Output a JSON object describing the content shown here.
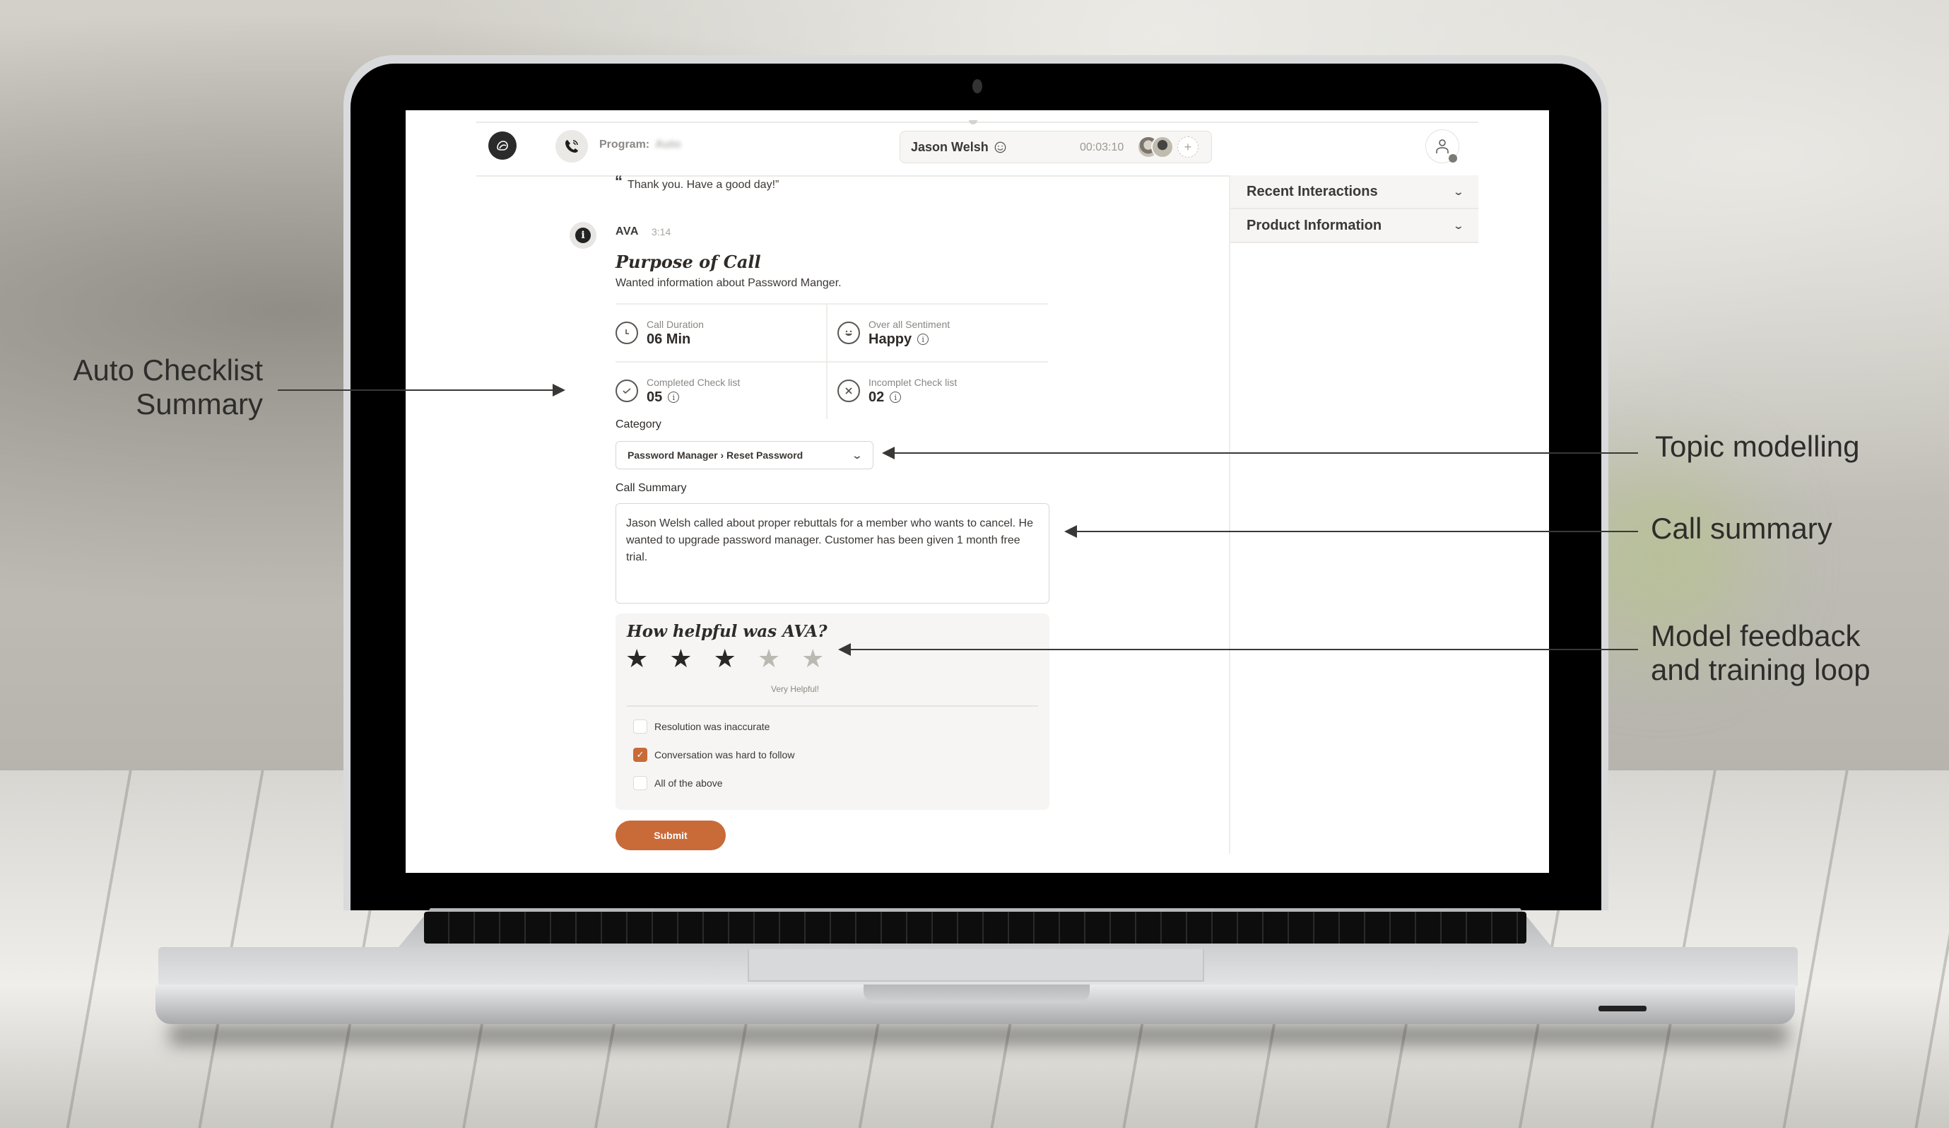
{
  "annotations": {
    "left": {
      "line1": "Auto Checklist",
      "line2": "Summary"
    },
    "topic": "Topic modelling",
    "summary": "Call summary",
    "feedback": {
      "line1": "Model feedback",
      "line2": "and training loop"
    }
  },
  "header": {
    "program_label": "Program:",
    "program_value": "Auto",
    "caller_name": "Jason Welsh",
    "call_timer": "00:03:10",
    "add_participant": "+",
    "icons": {
      "logo": "brand-logo-icon",
      "phone": "phone-icon",
      "sentiment": "smiley-icon",
      "user": "user-icon"
    }
  },
  "right_panel": {
    "sections": [
      {
        "label": "Recent Interactions"
      },
      {
        "label": "Product Information"
      }
    ]
  },
  "conversation": {
    "last_message": "Thank you. Have a good day!”",
    "ava": {
      "name": "AVA",
      "time": "3:14",
      "purpose_title": "Purpose of Call",
      "purpose_text": "Wanted information about Password Manger."
    },
    "stats": {
      "call_duration": {
        "label": "Call Duration",
        "value": "06 Min"
      },
      "sentiment": {
        "label": "Over all Sentiment",
        "value": "Happy"
      },
      "completed": {
        "label": "Completed Check list",
        "value": "05"
      },
      "incomplete": {
        "label": "Incomplet Check list",
        "value": "02"
      }
    },
    "category": {
      "label": "Category",
      "selected": "Password Manager › Reset Password"
    },
    "call_summary": {
      "label": "Call Summary",
      "value": "Jason Welsh called about proper rebuttals for a member who wants to cancel. He wanted to upgrade password manager. Customer has been given 1 month free trial.\n\n"
    },
    "feedback": {
      "title": "How helpful was AVA?",
      "rating": 3,
      "max_rating": 5,
      "rating_label": "Very Helpful!",
      "options": [
        {
          "label": "Resolution was inaccurate",
          "checked": false
        },
        {
          "label": "Conversation was hard to follow",
          "checked": true
        },
        {
          "label": "All of the above",
          "checked": false
        }
      ],
      "submit_label": "Submit"
    }
  },
  "colors": {
    "accent": "#c96a39",
    "text": "#2e2b28",
    "muted": "#8a8782",
    "panel_bg": "#f6f5f3"
  }
}
